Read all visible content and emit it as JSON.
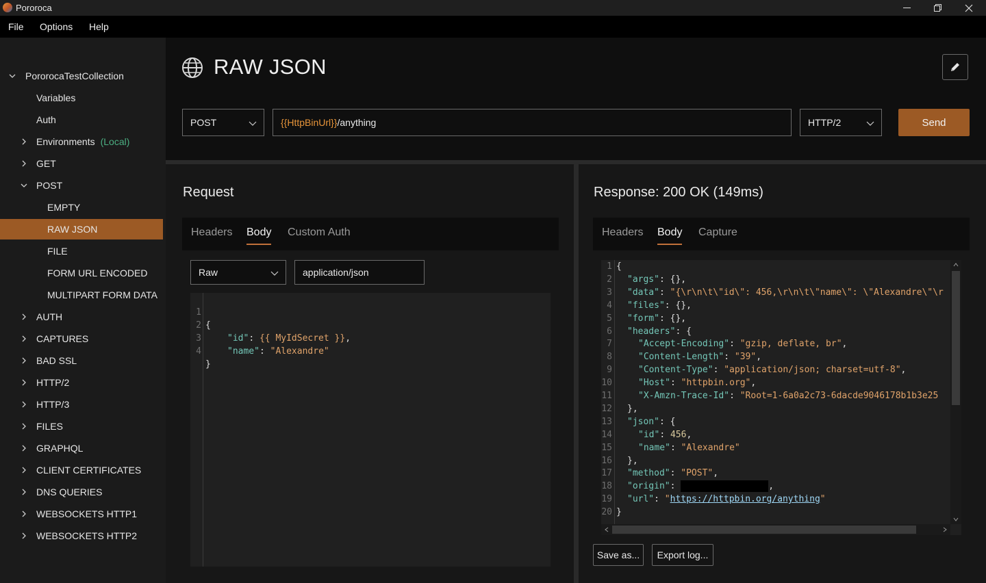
{
  "window": {
    "title": "Pororoca",
    "controls": {
      "minimize": "–",
      "maximize": "❐",
      "close": "✕"
    }
  },
  "menu": [
    "File",
    "Options",
    "Help"
  ],
  "sidebar": {
    "collection": "PororocaTestCollection",
    "items": [
      {
        "label": "Variables"
      },
      {
        "label": "Auth"
      },
      {
        "label": "Environments",
        "tag": "(Local)"
      },
      {
        "label": "GET"
      },
      {
        "label": "POST"
      },
      {
        "label": "EMPTY"
      },
      {
        "label": "RAW JSON"
      },
      {
        "label": "FILE"
      },
      {
        "label": "FORM URL ENCODED"
      },
      {
        "label": "MULTIPART FORM DATA"
      },
      {
        "label": "AUTH"
      },
      {
        "label": "CAPTURES"
      },
      {
        "label": "BAD SSL"
      },
      {
        "label": "HTTP/2"
      },
      {
        "label": "HTTP/3"
      },
      {
        "label": "FILES"
      },
      {
        "label": "GRAPHQL"
      },
      {
        "label": "CLIENT CERTIFICATES"
      },
      {
        "label": "DNS QUERIES"
      },
      {
        "label": "WEBSOCKETS HTTP1"
      },
      {
        "label": "WEBSOCKETS HTTP2"
      }
    ]
  },
  "header": {
    "title": "RAW JSON",
    "method": "POST",
    "url_variable": "{{HttpBinUrl}}",
    "url_path": "/anything",
    "http_version": "HTTP/2",
    "send_label": "Send"
  },
  "request": {
    "title": "Request",
    "tabs": [
      "Headers",
      "Body",
      "Custom Auth"
    ],
    "active_tab": "Body",
    "body_mode": "Raw",
    "content_type": "application/json",
    "line_numbers": [
      "1",
      "2",
      "3",
      "4"
    ],
    "code": [
      "{",
      "\"id\"",
      ": ",
      "{{ MyIdSecret }}",
      ",",
      "\"name\"",
      ": ",
      "\"Alexandre\"",
      "}"
    ]
  },
  "response": {
    "title": "Response: 200 OK (149ms)",
    "tabs": [
      "Headers",
      "Body",
      "Capture"
    ],
    "active_tab": "Body",
    "line_numbers": [
      "1",
      "2",
      "3",
      "4",
      "5",
      "6",
      "7",
      "8",
      "9",
      "10",
      "11",
      "12",
      "13",
      "14",
      "15",
      "16",
      "17",
      "18",
      "19",
      "20"
    ],
    "lines": [
      "{",
      "\"args\"|: {},",
      "\"data\"|: |\"{\\r\\n\\t\\\"id\\\": 456,\\r\\n\\t\\\"name\\\": \\\"Alexandre\\\"\\r",
      "\"files\"|: {},",
      "\"form\"|: {},",
      "\"headers\"|: {",
      "\"Accept-Encoding\"|: |\"gzip, deflate, br\"|,",
      "\"Content-Length\"|: |\"39\"|,",
      "\"Content-Type\"|: |\"application/json; charset=utf-8\"|,",
      "\"Host\"|: |\"httpbin.org\"|,",
      "\"X-Amzn-Trace-Id\"|: |\"Root=1-6a0a2c73-6dacde9046178b1b3e25",
      "},",
      "\"json\"|: {",
      "\"id\"|: |456|,",
      "\"name\"|: |\"Alexandre\"",
      "},",
      "\"method\"|: |\"POST\"|,",
      "\"origin\"|: ",
      "\"url\"|: |\"|https://httpbin.org/anything|\"",
      "}"
    ],
    "save_label": "Save as...",
    "export_label": "Export log..."
  },
  "colors": {
    "accent": "#9c5a25",
    "local_tag": "#4caf82",
    "json_key": "#74c7b8",
    "json_string": "#e0a36a"
  }
}
